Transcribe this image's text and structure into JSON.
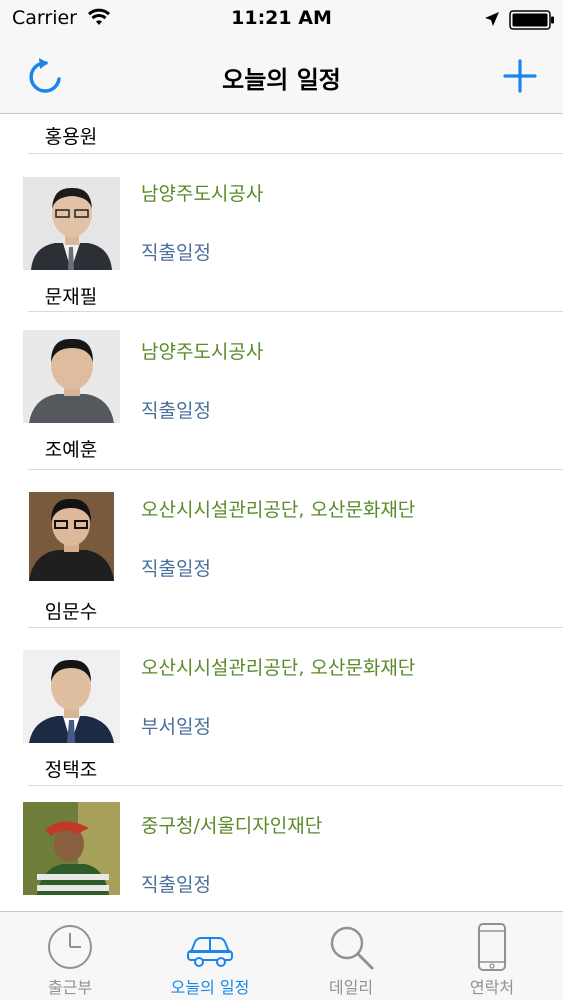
{
  "status_bar": {
    "carrier": "Carrier",
    "time": "11:21 AM",
    "wifi_icon": "wifi-icon",
    "location_icon": "location-arrow-icon",
    "battery_icon": "battery-icon"
  },
  "nav": {
    "title": "오늘의 일정",
    "left_icon": "refresh-icon",
    "right_icon": "plus-icon",
    "accent": "#1a86ea"
  },
  "list": {
    "partial_name": "홍용원",
    "rows": [
      {
        "name": "문재필",
        "org": "남양주도시공사",
        "schedule": "직출일정"
      },
      {
        "name": "조예훈",
        "org": "남양주도시공사",
        "schedule": "직출일정"
      },
      {
        "name": "임문수",
        "org": "오산시시설관리공단, 오산문화재단",
        "schedule": "직출일정"
      },
      {
        "name": "정택조",
        "org": "오산시시설관리공단, 오산문화재단",
        "schedule": "부서일정"
      },
      {
        "name": "",
        "org": "중구청/서울디자인재단",
        "schedule": "직출일정"
      }
    ]
  },
  "tabs": [
    {
      "label": "출근부",
      "icon": "clock-icon"
    },
    {
      "label": "오늘의 일정",
      "icon": "car-icon",
      "active": true
    },
    {
      "label": "데일리",
      "icon": "search-icon"
    },
    {
      "label": "연락처",
      "icon": "phone-icon"
    }
  ],
  "colors": {
    "org_text": "#5a8a2a",
    "schedule_text": "#4a6f9a",
    "tab_active": "#1a86ea",
    "tab_inactive": "#929292"
  }
}
